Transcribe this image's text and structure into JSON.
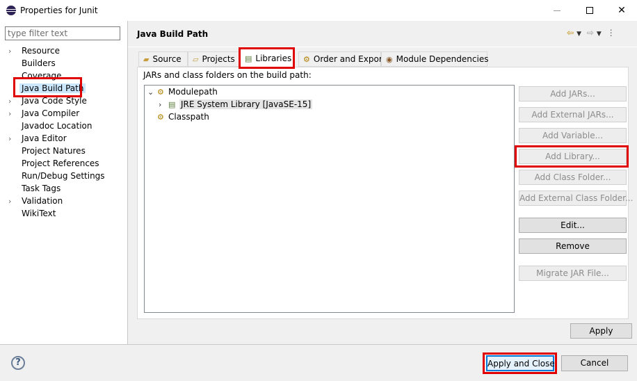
{
  "window": {
    "title": "Properties for Junit",
    "minimize": "—",
    "maximize": "",
    "close": "✕"
  },
  "filter": {
    "placeholder": "type filter text",
    "value": ""
  },
  "sidebar": {
    "items": [
      {
        "label": "Resource",
        "expandable": true
      },
      {
        "label": "Builders",
        "expandable": false
      },
      {
        "label": "Coverage",
        "expandable": false
      },
      {
        "label": "Java Build Path",
        "expandable": false,
        "selected": true
      },
      {
        "label": "Java Code Style",
        "expandable": true
      },
      {
        "label": "Java Compiler",
        "expandable": true
      },
      {
        "label": "Javadoc Location",
        "expandable": false
      },
      {
        "label": "Java Editor",
        "expandable": true
      },
      {
        "label": "Project Natures",
        "expandable": false
      },
      {
        "label": "Project References",
        "expandable": false
      },
      {
        "label": "Run/Debug Settings",
        "expandable": false
      },
      {
        "label": "Task Tags",
        "expandable": false
      },
      {
        "label": "Validation",
        "expandable": true
      },
      {
        "label": "WikiText",
        "expandable": false
      }
    ]
  },
  "page": {
    "title": "Java Build Path"
  },
  "tabs": [
    {
      "label": "Source",
      "icon": "source-folder-icon"
    },
    {
      "label": "Projects",
      "icon": "projects-folder-icon"
    },
    {
      "label": "Libraries",
      "icon": "libraries-icon",
      "active": true
    },
    {
      "label": "Order and Export",
      "icon": "order-export-icon"
    },
    {
      "label": "Module Dependencies",
      "icon": "module-icon"
    }
  ],
  "libraries": {
    "hint": "JARs and class folders on the build path:",
    "tree": {
      "modulepath": "Modulepath",
      "jre": "JRE System Library [JavaSE-15]",
      "classpath": "Classpath"
    },
    "buttons": {
      "add_jars": "Add JARs...",
      "add_external_jars": "Add External JARs...",
      "add_variable": "Add Variable...",
      "add_library": "Add Library...",
      "add_class_folder": "Add Class Folder...",
      "add_external_class_folder": "Add External Class Folder...",
      "edit": "Edit...",
      "remove": "Remove",
      "migrate_jar": "Migrate JAR File..."
    }
  },
  "apply": "Apply",
  "footer": {
    "help": "?",
    "apply_and_close": "Apply and Close",
    "cancel": "Cancel"
  }
}
